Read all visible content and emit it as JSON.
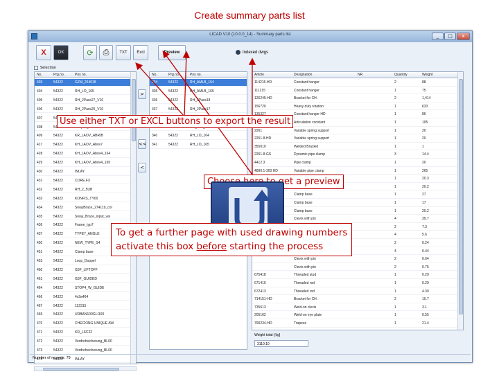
{
  "slide": {
    "title": "Create summary parts list"
  },
  "window": {
    "title": "LICAD V10 (10.0.0_14) - Summary parts list",
    "minimize": "_",
    "maximize": "□",
    "close": "x"
  },
  "toolbar": {
    "cancel_label": "X",
    "ok_label": "OK",
    "txt_label": "TXT",
    "excel_label": "Excl",
    "preview_label": "Preview",
    "drawing_numbers_label": "Indexed dwgs"
  },
  "selection_label": "Selection",
  "left_table": {
    "headers": [
      "No.",
      "Prg.no.",
      "Pos no."
    ],
    "rows": [
      [
        "403",
        "54322",
        "GZM_254018"
      ],
      [
        "404",
        "54322",
        "RH_LO_165"
      ],
      [
        "405",
        "54322",
        "RH_2Pass27_V10"
      ],
      [
        "406",
        "54322",
        "RH_2Pass25_V10"
      ],
      [
        "407",
        "54322",
        "ZSLT1_C27_M"
      ],
      [
        "408",
        "54322",
        "Coupling..."
      ],
      [
        "409",
        "54322",
        "KR_LAOV_ABRIB"
      ],
      [
        "417",
        "54322",
        "KH_LAOV_Abov7"
      ],
      [
        "428",
        "54322",
        "KH_LAOV_Abov4_164"
      ],
      [
        "429",
        "54322",
        "KH_LAOV_Abov4_165"
      ],
      [
        "430",
        "54322",
        "INLAY"
      ],
      [
        "431",
        "54322",
        "CORE.FX"
      ],
      [
        "432",
        "54322",
        "RH_2_5UB"
      ],
      [
        "433",
        "54322",
        "KONFIS_TY00"
      ],
      [
        "434",
        "54322",
        "SwayBrace_274119_col"
      ],
      [
        "435",
        "54322",
        "Sway_Brace_input_var"
      ],
      [
        "436",
        "54322",
        "Frame_typ7"
      ],
      [
        "437",
        "54322",
        "TYPE7_ANGLE"
      ],
      [
        "450",
        "54322",
        "NEW_TYPE_S4"
      ],
      [
        "451",
        "54322",
        "Clamp base"
      ],
      [
        "453",
        "54322",
        "Loop_Doppel"
      ],
      [
        "460",
        "54322",
        "G3F_LIFTOFF"
      ],
      [
        "461",
        "54322",
        "G3F_GUIDED"
      ],
      [
        "464",
        "54322",
        "STOP4_W_GUIDE"
      ],
      [
        "466",
        "54322",
        "4c9a464"
      ],
      [
        "467",
        "54322",
        "112315"
      ],
      [
        "469",
        "54322",
        "URBAN100GLI100"
      ],
      [
        "470",
        "54322",
        "CHECKING UNIQUE AW"
      ],
      [
        "471",
        "54322",
        "KR_LSC22"
      ],
      [
        "472",
        "54322",
        "Verdrehsicherung_BL00"
      ],
      [
        "473",
        "54322",
        "Verdrehsicherung_BL00"
      ],
      [
        "474",
        "54322",
        "INLAY"
      ]
    ]
  },
  "move_buttons": [
    ">",
    ">>",
    "<<",
    "<"
  ],
  "middle_table": {
    "headers": [
      "No.",
      "Prg.no.",
      "Pos no."
    ],
    "rows": [
      [
        "334",
        "54322",
        "RH_AMLB_164"
      ],
      [
        "335",
        "54322",
        "RH_AMLB_165"
      ],
      [
        "336",
        "54322",
        "RH_2Pass18"
      ],
      [
        "337",
        "54322",
        "RH_2Pass17"
      ],
      [
        "338",
        "54322",
        "RH_LSF_164"
      ],
      [
        "339",
        "54322",
        "RH_LSF_165"
      ],
      [
        "340",
        "54322",
        "RH_LO_164"
      ],
      [
        "341",
        "54322",
        "RH_LO_165"
      ]
    ]
  },
  "right_table": {
    "headers": [
      "Article",
      "Designation",
      "NR",
      "Quantity",
      "Weight"
    ],
    "rows": [
      [
        "114215-HD",
        "Constant hanger",
        "2",
        "88"
      ],
      [
        "111215",
        "Constant hanger",
        "1",
        "75"
      ],
      [
        "126245-HD",
        "Bracket for CH.",
        "2",
        "1,414"
      ],
      [
        "156720",
        "Heavy duty rotation",
        "1",
        "633"
      ],
      [
        "135327",
        "Constant hanger HD",
        "1",
        "86"
      ],
      [
        "120187",
        "Articulation constant",
        "1",
        "105"
      ],
      [
        "2261",
        "Variable spring support",
        "1",
        "20"
      ],
      [
        "2261.8-HD",
        "Variable spring support",
        "1",
        "20"
      ],
      [
        "355010",
        "Welded Bracket",
        "1",
        "1"
      ],
      [
        "2261.8-GS",
        "Dynamic pipe clamp",
        "3",
        "14.4"
      ],
      [
        "4412.3",
        "Pipe clamp",
        "1",
        "20"
      ],
      [
        "4890.1-300 HD",
        "Variable pipe clamp",
        "1",
        "265"
      ],
      [
        "480735",
        "Clamp base",
        "1",
        "20.3"
      ],
      [
        "412.25-10",
        "Clamp base",
        "1",
        "20.2"
      ],
      [
        "",
        "Clamp base",
        "1",
        "27"
      ],
      [
        "",
        "Clamp base",
        "1",
        "17"
      ],
      [
        "",
        "Clamp base",
        "1",
        "20.2"
      ],
      [
        "",
        "Clevis with pin",
        "4",
        "39.7"
      ],
      [
        "",
        "Clevis with pin",
        "2",
        "7.3"
      ],
      [
        "",
        "Clevis with pin",
        "4",
        "5.6"
      ],
      [
        "",
        "Clevis with pin",
        "2",
        "0.24"
      ],
      [
        "",
        "Clevis with pin",
        "4",
        "0.44"
      ],
      [
        "",
        "Clevis with pin",
        "2",
        "0.64"
      ],
      [
        "",
        "Clevis with pin",
        "2",
        "0.75"
      ],
      [
        "675418",
        "Threaded stud",
        "1",
        "0.29"
      ],
      [
        "671410",
        "Threaded rod",
        "1",
        "0.29"
      ],
      [
        "672413",
        "Threaded rod",
        "1",
        "4.30"
      ],
      [
        "714151-HD",
        "Bracket for CH.",
        "2",
        "10.7"
      ],
      [
        "735613",
        "Weld-on clevis",
        "1",
        "3.1"
      ],
      [
        "205102",
        "Weld-on eye plate",
        "1",
        "0.55"
      ],
      [
        "790234-HD",
        "Trapeze",
        "1",
        "21.4"
      ]
    ]
  },
  "weight_total": {
    "label": "Weight total: [kg]",
    "value": "3110.10"
  },
  "status": "Number of records: 79",
  "callouts": {
    "export": "Use either TXT or EXCL buttons to export the result",
    "preview": "Choose here to get a preview",
    "drawing_line1": "To get a further page with used drawing numbers",
    "drawing_line2_pre": "activate this box ",
    "drawing_line2_underlined": "before",
    "drawing_line2_post": " starting the process"
  },
  "colors": {
    "accent": "#c00000",
    "selection": "#3b7dd8",
    "window_frame": "#6b89b0"
  }
}
